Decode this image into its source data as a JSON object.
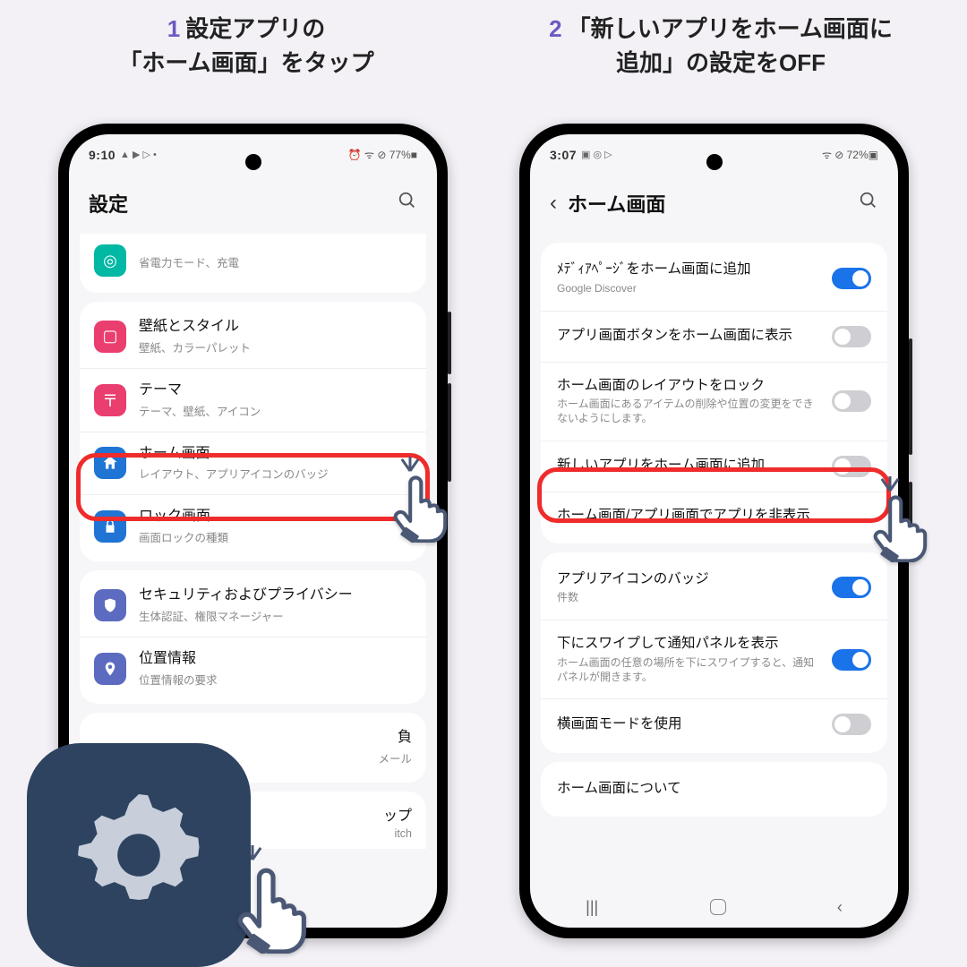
{
  "captions": {
    "step1_num": "1",
    "step1_text": "設定アプリの\n「ホーム画面」をタップ",
    "step2_num": "2",
    "step2_text": "「新しいアプリをホーム画面に\n追加」の設定をOFF"
  },
  "phone1": {
    "status": {
      "time": "9:10",
      "left_icons": "▲ ▶ ▷ •",
      "right_icons": "⏰ ᯤ ⊘ 77%■"
    },
    "header": {
      "title": "設定"
    },
    "rows": {
      "battery": {
        "title_tail": "省電力モード、充電"
      },
      "wallpaper": {
        "title": "壁紙とスタイル",
        "sub": "壁紙、カラーパレット"
      },
      "themes": {
        "title": "テーマ",
        "sub": "テーマ、壁紙、アイコン"
      },
      "home": {
        "title": "ホーム画面",
        "sub": "レイアウト、アプリアイコンのバッジ"
      },
      "lock": {
        "title": "ロック画面",
        "sub": "画面ロックの種類"
      },
      "security": {
        "title": "セキュリティおよびプライバシー",
        "sub": "生体認証、権限マネージャー"
      },
      "location": {
        "title": "位置情報",
        "sub": "位置情報の要求"
      },
      "hidden1": {
        "tail1": "負",
        "tail2": "メール"
      },
      "hidden2": {
        "tail1": "ップ",
        "tail2": "itch"
      }
    }
  },
  "phone2": {
    "status": {
      "time": "3:07",
      "left_icons": "▣ ◎ ▷",
      "right_icons": "ᯤ ⊘ 72%▣"
    },
    "header": {
      "title": "ホーム画面"
    },
    "rows": {
      "media": {
        "title": "ﾒﾃﾞｨｱﾍﾟｰｼﾞをホーム画面に追加",
        "sub": "Google Discover",
        "on": true
      },
      "appbtn": {
        "title": "アプリ画面ボタンをホーム画面に表示",
        "on": false
      },
      "lock": {
        "title": "ホーム画面のレイアウトをロック",
        "sub": "ホーム画面にあるアイテムの削除や位置の変更をできないようにします。",
        "on": false
      },
      "addnew": {
        "title": "新しいアプリをホーム画面に追加",
        "on": false
      },
      "hide": {
        "title": "ホーム画面/アプリ画面でアプリを非表示"
      },
      "badge": {
        "title": "アプリアイコンのバッジ",
        "sub": "件数",
        "on": true
      },
      "swipe": {
        "title": "下にスワイプして通知パネルを表示",
        "sub": "ホーム画面の任意の場所を下にスワイプすると、通知パネルが開きます。",
        "on": true
      },
      "land": {
        "title": "横画面モードを使用",
        "on": false
      },
      "about": {
        "title": "ホーム画面について"
      }
    }
  }
}
